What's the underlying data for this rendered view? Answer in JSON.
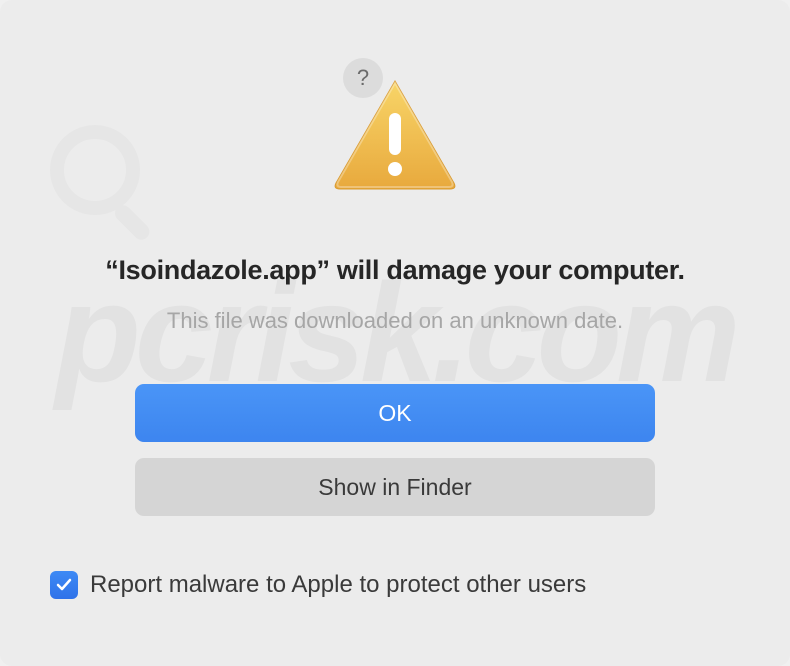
{
  "dialog": {
    "headline": "“Isoindazole.app” will damage your computer.",
    "subtext": "This file was downloaded on an unknown date.",
    "help_symbol": "?"
  },
  "buttons": {
    "ok": "OK",
    "show_in_finder": "Show in Finder"
  },
  "checkbox": {
    "label": "Report malware to Apple to protect other users",
    "checked": true
  },
  "watermark": {
    "text": "pcrisk.com"
  }
}
